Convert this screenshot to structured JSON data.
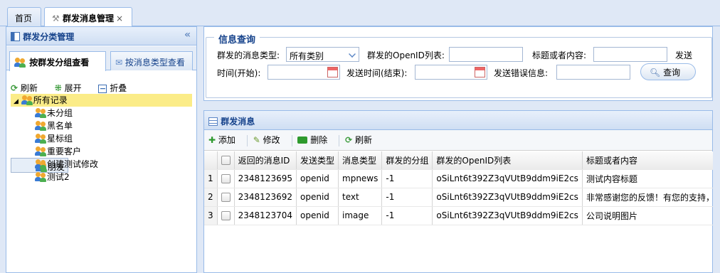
{
  "tabs": [
    {
      "label": "首页"
    },
    {
      "label": "群发消息管理",
      "close": "×"
    }
  ],
  "left_panel": {
    "title": "群发分类管理",
    "collapse": "«",
    "subtabs": [
      {
        "label": "按群发分组查看"
      },
      {
        "label": "按消息类型查看"
      }
    ],
    "toolbar": {
      "refresh": "刷新",
      "expand": "展开",
      "collapse": "折叠"
    },
    "tree": {
      "root": "所有记录",
      "children": [
        "未分组",
        "黑名单",
        "星标组",
        "重要客户",
        "朋友",
        "创建测试修改",
        "测试2"
      ]
    }
  },
  "query": {
    "title": "信息查询",
    "msg_type_label": "群发的消息类型:",
    "msg_type_value": "所有类别",
    "openid_label": "群发的OpenID列表:",
    "title_label": "标题或者内容:",
    "send_time_start_label_a": "发送",
    "send_time_start_label_b": "时间(开始):",
    "send_time_end_label": "发送时间(结束):",
    "error_label": "发送错误信息:",
    "search_button": "查询"
  },
  "grid": {
    "title": "群发消息",
    "toolbar": {
      "add": "添加",
      "edit": "修改",
      "delete": "删除",
      "refresh": "刷新"
    },
    "columns": [
      "返回的消息ID",
      "发送类型",
      "消息类型",
      "群发的分组",
      "群发的OpenID列表",
      "标题或者内容"
    ],
    "rows": [
      {
        "n": "1",
        "id": "2348123695",
        "send": "openid",
        "type": "mpnews",
        "group": "-1",
        "openid": "oSiLnt6t392Z3qVUtB9ddm9iE2cs",
        "content": "测试内容标题"
      },
      {
        "n": "2",
        "id": "2348123692",
        "send": "openid",
        "type": "text",
        "group": "-1",
        "openid": "oSiLnt6t392Z3qVUtB9ddm9iE2cs",
        "content": "非常感谢您的反馈！有您的支持，"
      },
      {
        "n": "3",
        "id": "2348123704",
        "send": "openid",
        "type": "image",
        "group": "-1",
        "openid": "oSiLnt6t392Z3qVUtB9ddm9iE2cs",
        "content": "公司说明图片"
      }
    ]
  }
}
